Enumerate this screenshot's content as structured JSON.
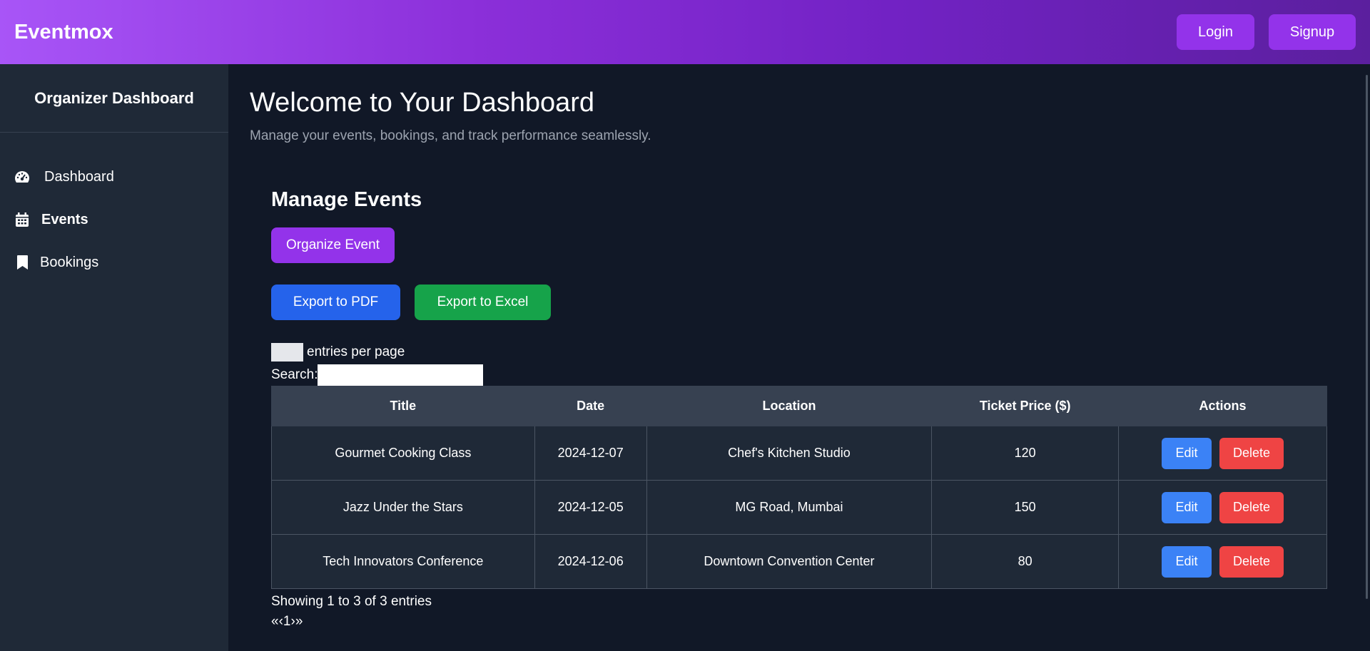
{
  "header": {
    "brand": "Eventmox",
    "login_label": "Login",
    "signup_label": "Signup"
  },
  "sidebar": {
    "title": "Organizer Dashboard",
    "items": [
      {
        "label": "Dashboard",
        "icon": "tachometer-icon",
        "active": false
      },
      {
        "label": "Events",
        "icon": "calendar-icon",
        "active": true
      },
      {
        "label": "Bookings",
        "icon": "bookmark-icon",
        "active": false
      }
    ]
  },
  "main": {
    "title": "Welcome to Your Dashboard",
    "subtitle": "Manage your events, bookings, and track performance seamlessly.",
    "section_title": "Manage Events",
    "organize_label": "Organize Event",
    "export_pdf_label": "Export to PDF",
    "export_excel_label": "Export to Excel",
    "entries_text": "entries per page",
    "search_label": "Search:",
    "search_value": "",
    "table": {
      "columns": [
        "Title",
        "Date",
        "Location",
        "Ticket Price ($)",
        "Actions"
      ],
      "rows": [
        {
          "title": "Gourmet Cooking Class",
          "date": "2024-12-07",
          "location": "Chef's Kitchen Studio",
          "price": "120"
        },
        {
          "title": "Jazz Under the Stars",
          "date": "2024-12-05",
          "location": "MG Road, Mumbai",
          "price": "150"
        },
        {
          "title": "Tech Innovators Conference",
          "date": "2024-12-06",
          "location": "Downtown Convention Center",
          "price": "80"
        }
      ],
      "edit_label": "Edit",
      "delete_label": "Delete"
    },
    "info_text": "Showing 1 to 3 of 3 entries",
    "pager": {
      "first": "«",
      "prev": "‹",
      "page": "1",
      "next": "›",
      "last": "»"
    }
  },
  "colors": {
    "accent": "#9333ea",
    "pdf": "#2563eb",
    "excel": "#16a34a",
    "edit": "#3b82f6",
    "delete": "#ef4444",
    "background": "#111827",
    "sidebar": "#1f2937"
  }
}
